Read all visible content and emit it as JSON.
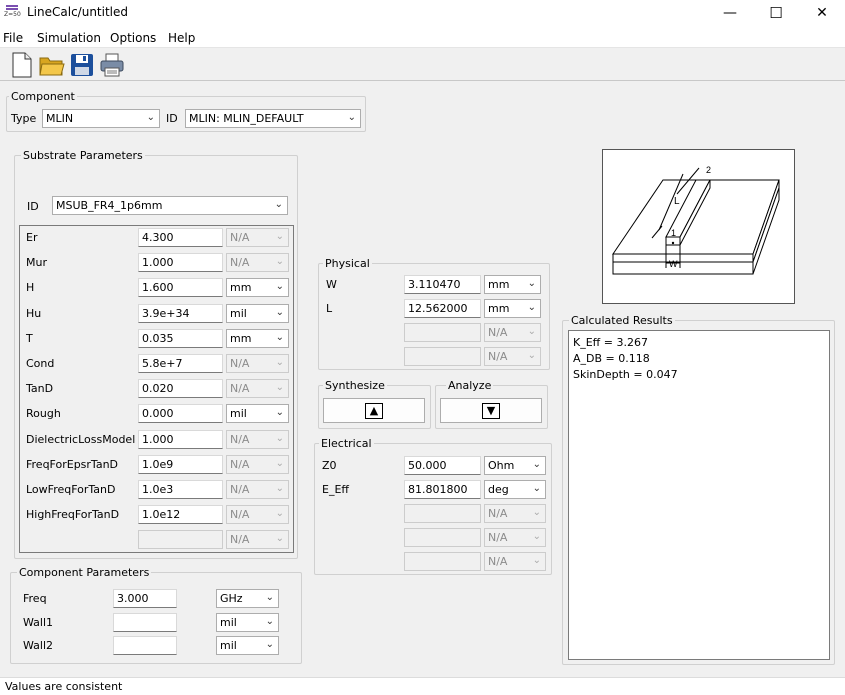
{
  "app": {
    "title": "LineCalc/untitled",
    "icon_text": "Z=50",
    "controls": {
      "minimize": "—",
      "maximize": "☐",
      "close": "✕"
    }
  },
  "menu": [
    "File",
    "Simulation",
    "Options",
    "Help"
  ],
  "toolbar": [
    "new-file-icon",
    "open-folder-icon",
    "save-icon",
    "print-icon"
  ],
  "component": {
    "group_label": "Component",
    "type_label": "Type",
    "type_value": "MLIN",
    "id_label": "ID",
    "id_value": "MLIN: MLIN_DEFAULT"
  },
  "substrate": {
    "group_label": "Substrate Parameters",
    "id_label": "ID",
    "id_value": "MSUB_FR4_1p6mm",
    "rows": [
      {
        "name": "Er",
        "value": "4.300",
        "unit": "N/A",
        "unit_enabled": false
      },
      {
        "name": "Mur",
        "value": "1.000",
        "unit": "N/A",
        "unit_enabled": false
      },
      {
        "name": "H",
        "value": "1.600",
        "unit": "mm",
        "unit_enabled": true
      },
      {
        "name": "Hu",
        "value": "3.9e+34",
        "unit": "mil",
        "unit_enabled": true
      },
      {
        "name": "T",
        "value": "0.035",
        "unit": "mm",
        "unit_enabled": true
      },
      {
        "name": "Cond",
        "value": "5.8e+7",
        "unit": "N/A",
        "unit_enabled": false
      },
      {
        "name": "TanD",
        "value": "0.020",
        "unit": "N/A",
        "unit_enabled": false
      },
      {
        "name": "Rough",
        "value": "0.000",
        "unit": "mil",
        "unit_enabled": true
      },
      {
        "name": "DielectricLossModel",
        "value": "1.000",
        "unit": "N/A",
        "unit_enabled": false
      },
      {
        "name": "FreqForEpsrTanD",
        "value": "1.0e9",
        "unit": "N/A",
        "unit_enabled": false
      },
      {
        "name": "LowFreqForTanD",
        "value": "1.0e3",
        "unit": "N/A",
        "unit_enabled": false
      },
      {
        "name": "HighFreqForTanD",
        "value": "1.0e12",
        "unit": "N/A",
        "unit_enabled": false
      },
      {
        "name": "",
        "value": "",
        "unit": "N/A",
        "unit_enabled": false
      }
    ]
  },
  "component_params": {
    "group_label": "Component Parameters",
    "rows": [
      {
        "name": "Freq",
        "value": "3.000",
        "unit": "GHz"
      },
      {
        "name": "Wall1",
        "value": "",
        "unit": "mil"
      },
      {
        "name": "Wall2",
        "value": "",
        "unit": "mil"
      }
    ]
  },
  "physical": {
    "group_label": "Physical",
    "rows": [
      {
        "name": "W",
        "value": "3.110470",
        "unit": "mm",
        "unit_enabled": true
      },
      {
        "name": "L",
        "value": "12.562000",
        "unit": "mm",
        "unit_enabled": true
      },
      {
        "name": "",
        "value": "",
        "unit": "N/A",
        "unit_enabled": false
      },
      {
        "name": "",
        "value": "",
        "unit": "N/A",
        "unit_enabled": false
      }
    ]
  },
  "synthesize": {
    "label": "Synthesize",
    "arrow": "▲"
  },
  "analyze": {
    "label": "Analyze",
    "arrow": "▼"
  },
  "electrical": {
    "group_label": "Electrical",
    "rows": [
      {
        "name": "Z0",
        "value": "50.000",
        "unit": "Ohm",
        "unit_enabled": true
      },
      {
        "name": "E_Eff",
        "value": "81.801800",
        "unit": "deg",
        "unit_enabled": true
      },
      {
        "name": "",
        "value": "",
        "unit": "N/A",
        "unit_enabled": false
      },
      {
        "name": "",
        "value": "",
        "unit": "N/A",
        "unit_enabled": false
      },
      {
        "name": "",
        "value": "",
        "unit": "N/A",
        "unit_enabled": false
      }
    ]
  },
  "diagram": {
    "labels": {
      "port2": "2",
      "port1": "1",
      "length": "L",
      "width": "W"
    }
  },
  "results": {
    "group_label": "Calculated Results",
    "lines": [
      "K_Eff = 3.267",
      "A_DB = 0.118",
      "SkinDepth = 0.047"
    ]
  },
  "status": "Values are consistent"
}
